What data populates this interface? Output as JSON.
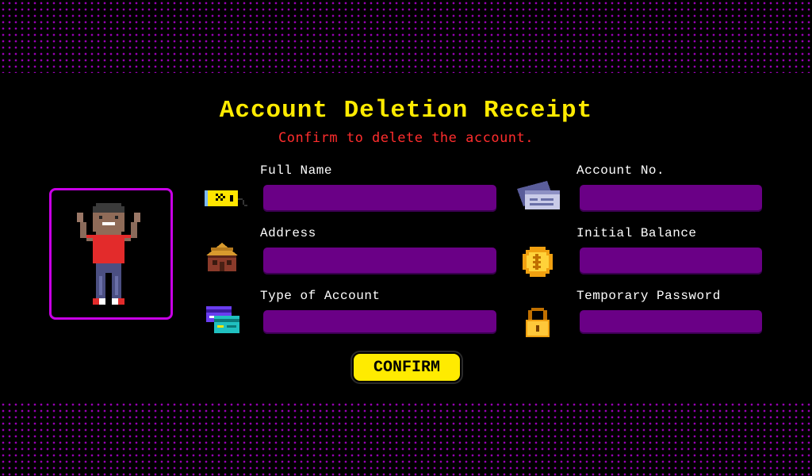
{
  "header": {
    "title": "Account Deletion Receipt",
    "subtitle": "Confirm to delete the account."
  },
  "fields": {
    "full_name": {
      "label": "Full Name",
      "value": ""
    },
    "account_no": {
      "label": "Account No.",
      "value": ""
    },
    "address": {
      "label": "Address",
      "value": ""
    },
    "initial_balance": {
      "label": "Initial Balance",
      "value": ""
    },
    "type_of_account": {
      "label": "Type of Account",
      "value": ""
    },
    "temporary_password": {
      "label": "Temporary Password",
      "value": ""
    }
  },
  "actions": {
    "confirm_label": "CONFIRM"
  },
  "icons": {
    "full_name": "id-tag-icon",
    "account_no": "bank-card-icon",
    "address": "house-icon",
    "initial_balance": "coin-icon",
    "type_of_account": "cards-icon",
    "temporary_password": "padlock-icon",
    "avatar": "pixel-person-avatar"
  },
  "colors": {
    "background": "#000000",
    "title": "#ffeb00",
    "subtitle": "#ff2d2d",
    "field": "#6a0086",
    "avatar_border": "#c800e6",
    "button": "#ffeb00",
    "dots": "#b000d0"
  }
}
